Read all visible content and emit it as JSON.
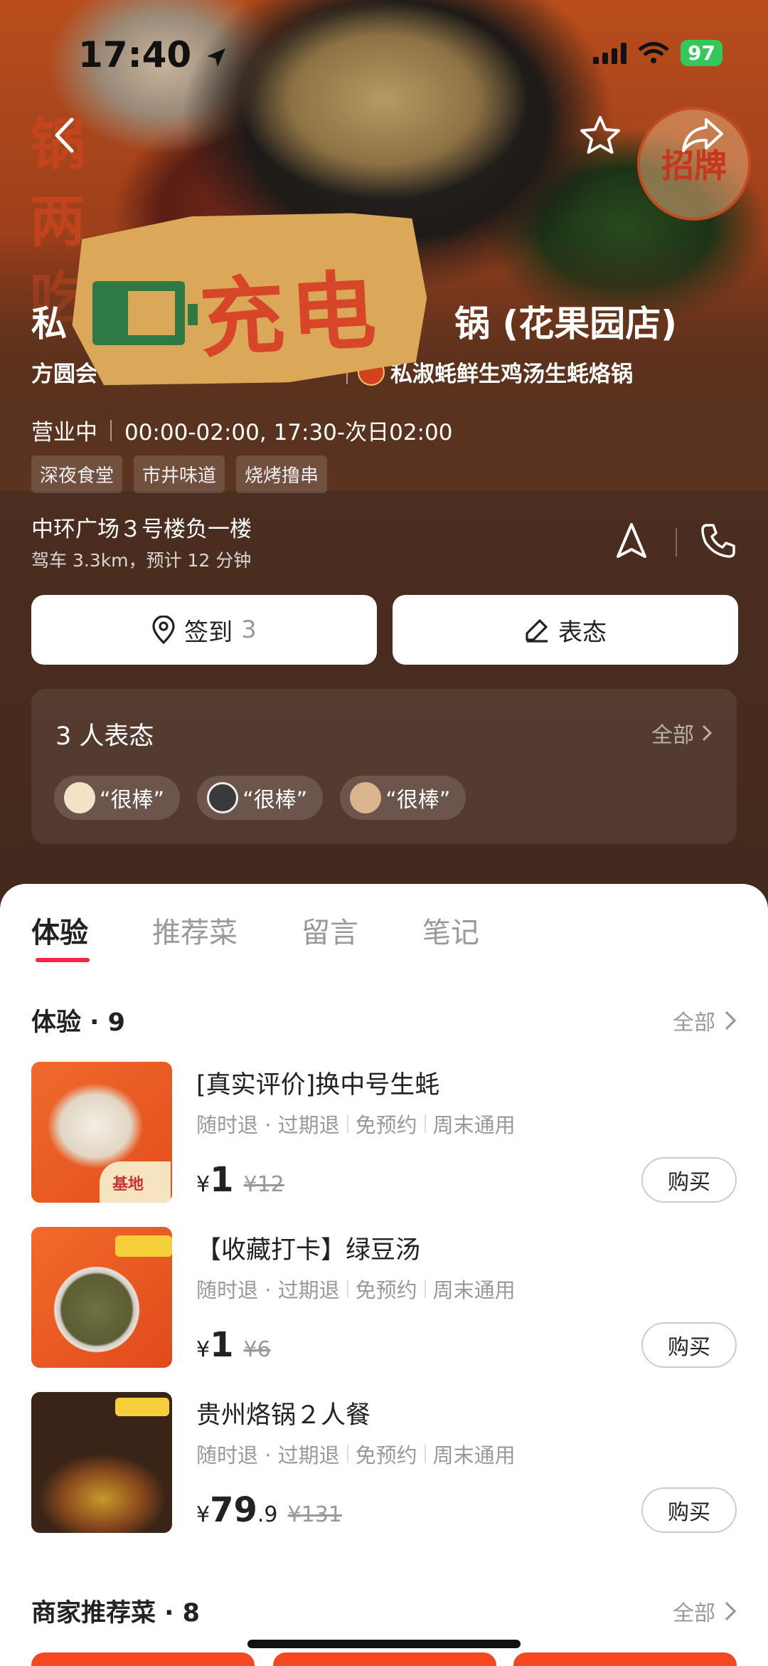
{
  "status_bar": {
    "time": "17:40",
    "battery": "97"
  },
  "store": {
    "name": "私淑蚝鲜生鸡汤生蚝烙锅 (花果园店)",
    "name_visible": "私",
    "name_tail": "锅 (花果园店)",
    "area": "方圆会",
    "brand": "私淑蚝鲜生鸡汤生蚝烙锅",
    "status": "营业中",
    "hours": "00:00-02:00, 17:30-次日02:00",
    "tags": [
      "深夜食堂",
      "市井味道",
      "烧烤撸串"
    ],
    "address": "中环广场３号楼负一楼",
    "distance": "驾车 3.3km，预计 12 分钟"
  },
  "hero": {
    "side_text": "锅两吃",
    "badge": "招牌",
    "sticker_text": "充电"
  },
  "actions": {
    "checkin_label": "签到",
    "checkin_count": "3",
    "react_label": "表态"
  },
  "reactions": {
    "title": "3 人表态",
    "all": "全部",
    "items": [
      {
        "text": "“很棒”",
        "avatar_color": "#f1e2c8"
      },
      {
        "text": "“很棒”",
        "avatar_color": "#3a3a3a"
      },
      {
        "text": "“很棒”",
        "avatar_color": "#d9b48c"
      }
    ]
  },
  "tabs": [
    {
      "label": "体验",
      "active": true
    },
    {
      "label": "推荐菜",
      "active": false
    },
    {
      "label": "留言",
      "active": false
    },
    {
      "label": "笔记",
      "active": false
    }
  ],
  "experience": {
    "title": "体验 · 9",
    "all": "全部",
    "deals": [
      {
        "name": "[真实评价]换中号生蚝",
        "meta": [
          "随时退 · 过期退",
          "免预约",
          "周末通用"
        ],
        "yen": "¥",
        "int": "1",
        "dec": "",
        "orig": "¥12",
        "buy": "购买"
      },
      {
        "name": "【收藏打卡】绿豆汤",
        "meta": [
          "随时退 · 过期退",
          "免预约",
          "周末通用"
        ],
        "yen": "¥",
        "int": "1",
        "dec": "",
        "orig": "¥6",
        "buy": "购买"
      },
      {
        "name": "贵州烙锅２人餐",
        "meta": [
          "随时退 · 过期退",
          "免预约",
          "周末通用"
        ],
        "yen": "¥",
        "int": "79",
        "dec": ".9",
        "orig": "¥131",
        "buy": "购买"
      }
    ]
  },
  "recommend": {
    "title": "商家推荐菜 · 8",
    "all": "全部"
  },
  "colors": {
    "accent": "#ff2442",
    "hero_bg": "#5b3421",
    "battery": "#34c759"
  }
}
